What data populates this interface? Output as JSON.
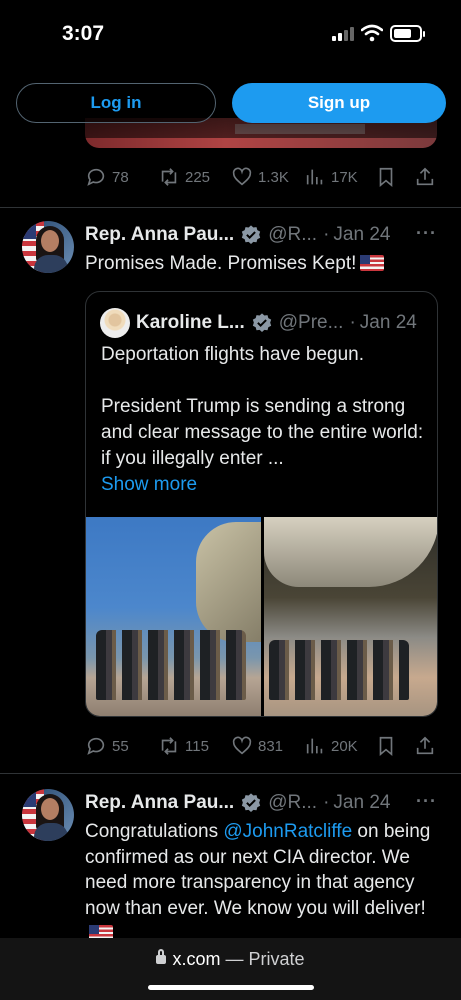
{
  "status": {
    "time": "3:07",
    "battery_level": 0.7
  },
  "auth": {
    "login_label": "Log in",
    "signup_label": "Sign up"
  },
  "prev_tweet": {
    "stats": {
      "replies": "78",
      "reposts": "225",
      "likes": "1.3K",
      "views": "17K"
    }
  },
  "tweets": [
    {
      "name": "Rep. Anna Pau...",
      "handle": "@R...",
      "sep": "·",
      "date": "Jan 24",
      "text": "Promises Made. Promises Kept!",
      "quote": {
        "name": "Karoline L...",
        "handle": "@Pre...",
        "sep": "·",
        "date": "Jan 24",
        "line1": "Deportation flights have begun.",
        "line2": "President Trump is sending a strong and clear message to the entire world: if you illegally enter ...",
        "show_more": "Show more"
      },
      "stats": {
        "replies": "55",
        "reposts": "115",
        "likes": "831",
        "views": "20K"
      }
    },
    {
      "name": "Rep. Anna Pau...",
      "handle": "@R...",
      "sep": "·",
      "date": "Jan 24",
      "text_before": "Congratulations ",
      "mention": "@JohnRatcliffe",
      "text_after": " on being confirmed as our next CIA director. We need more transparency in that agency now than ever. We know you will deliver!"
    }
  ],
  "browser": {
    "domain": "x.com",
    "mode": "— Private"
  },
  "icons": {
    "reply": "reply-icon",
    "repost": "repost-icon",
    "like": "heart-icon",
    "views": "views-icon",
    "bookmark": "bookmark-icon",
    "share": "share-icon",
    "verified": "verified-badge-icon",
    "more": "more-icon"
  },
  "colors": {
    "accent": "#1d9bf0",
    "muted": "#71767b",
    "border": "#2f3336",
    "background": "#000000"
  }
}
